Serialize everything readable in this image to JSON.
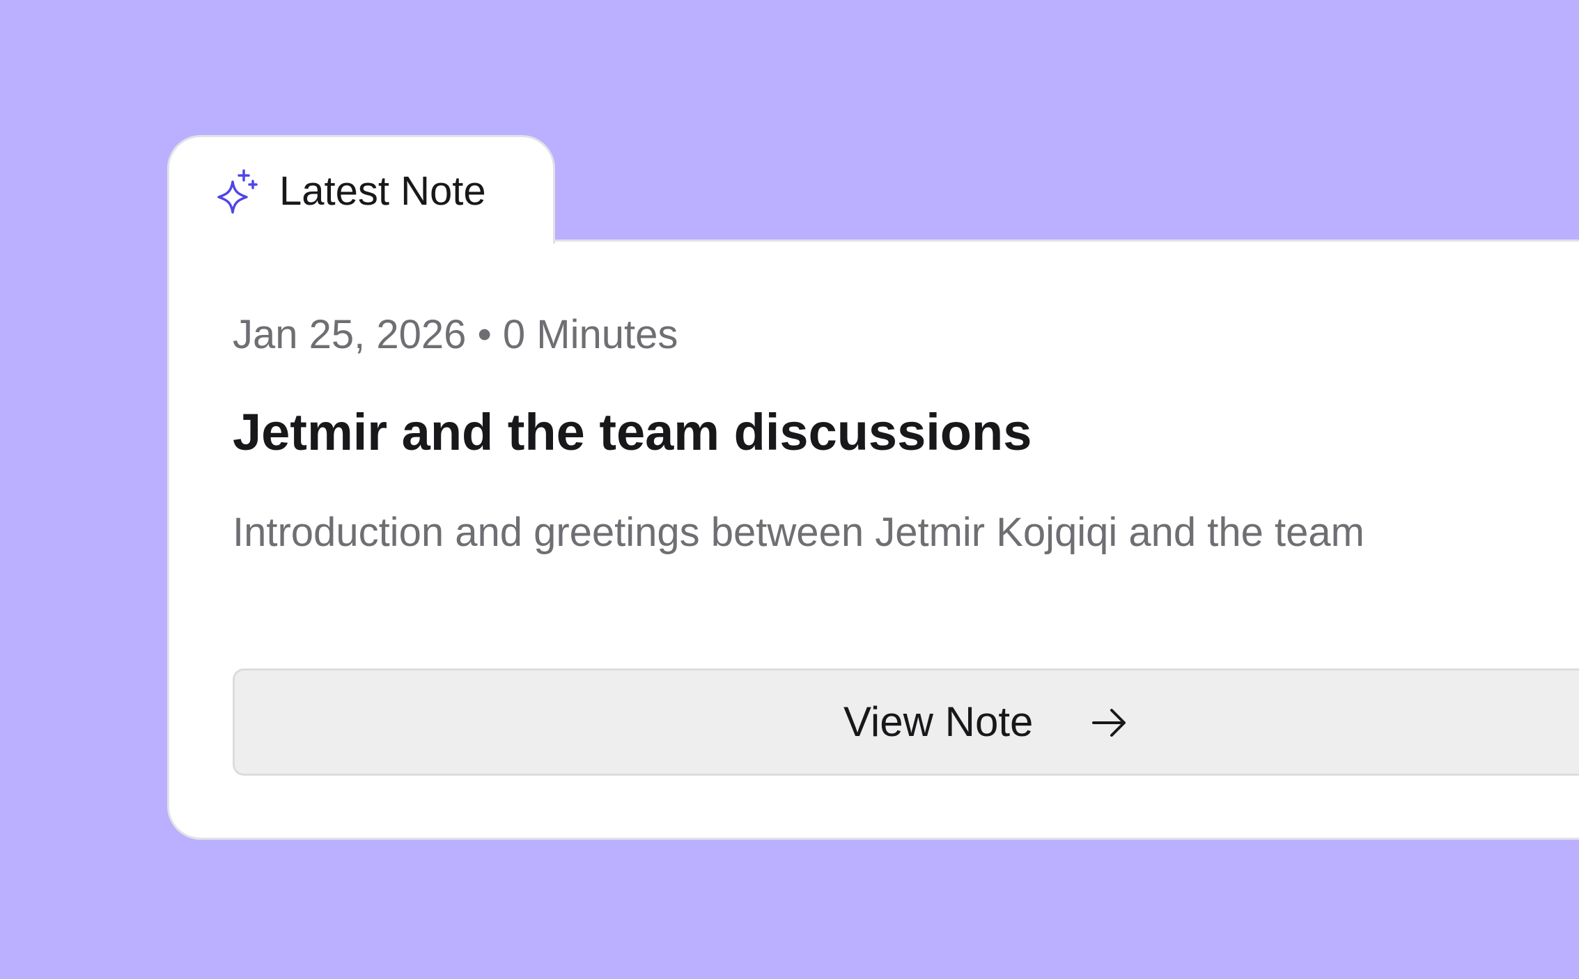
{
  "tab": {
    "label": "Latest Note",
    "icon": "sparkle-icon",
    "icon_color": "#4f46e5"
  },
  "note": {
    "meta": "Jan 25, 2026 • 0 Minutes",
    "title": "Jetmir and the team discussions",
    "summary": "Introduction and greetings between Jetmir Kojqiqi and the team"
  },
  "button": {
    "label": "View Note",
    "icon": "arrow-right-icon"
  },
  "colors": {
    "background": "#bbb0ff",
    "card": "#ffffff",
    "button": "#eeeeee"
  }
}
